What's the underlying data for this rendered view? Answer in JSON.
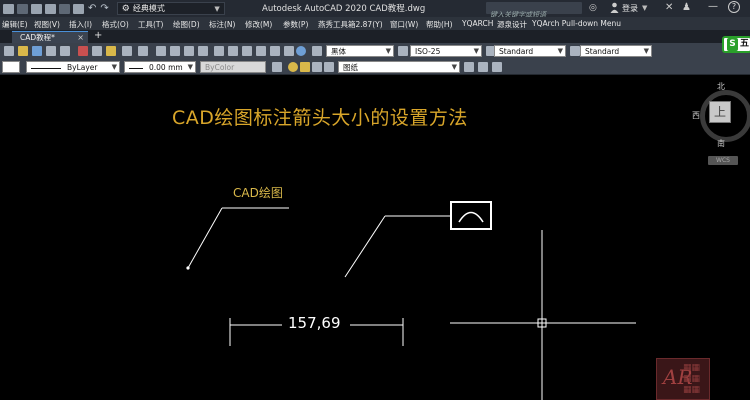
{
  "titlebar": {
    "workspace": "经典模式",
    "app_title": "Autodesk AutoCAD 2020    CAD教程.dwg",
    "search_placeholder": "键入关键字或短语",
    "login": "登录",
    "help_glyph": "?"
  },
  "menu": [
    "编辑(E)",
    "视图(V)",
    "插入(I)",
    "格式(O)",
    "工具(T)",
    "绘图(D)",
    "标注(N)",
    "修改(M)",
    "参数(P)",
    "燕秀工具箱2.87(Y)",
    "窗口(W)",
    "帮助(H)",
    "YQARCH",
    "源泉设计",
    "YQArch Pull-down Menu"
  ],
  "tabs": {
    "doc_tab": "CAD教程*",
    "close_glyph": "×",
    "new_tab_glyph": "+"
  },
  "toolbar": {
    "font_style": "黑体",
    "dim_style": "ISO-25",
    "table_style": "Standard",
    "multileader_style": "Standard",
    "linetype": "ByLayer",
    "lineweight": "0.00 mm",
    "color": "ByColor",
    "layer": "图纸",
    "five_badge_letter": "S",
    "five_badge_text": "五"
  },
  "drawing": {
    "title": "CAD绘图标注箭头大小的设置方法",
    "leader_text": "CAD绘图",
    "dimension_text": "157,69"
  },
  "viewcube": {
    "north": "北",
    "south": "南",
    "west": "西",
    "face": "上",
    "wcs": "WCS"
  },
  "colors": {
    "title_text": "#d9a62a",
    "leader_text": "#d9b84a",
    "geometry": "#ffffff",
    "canvas_bg": "#000000",
    "toolbar_bg": "#3a414c"
  }
}
